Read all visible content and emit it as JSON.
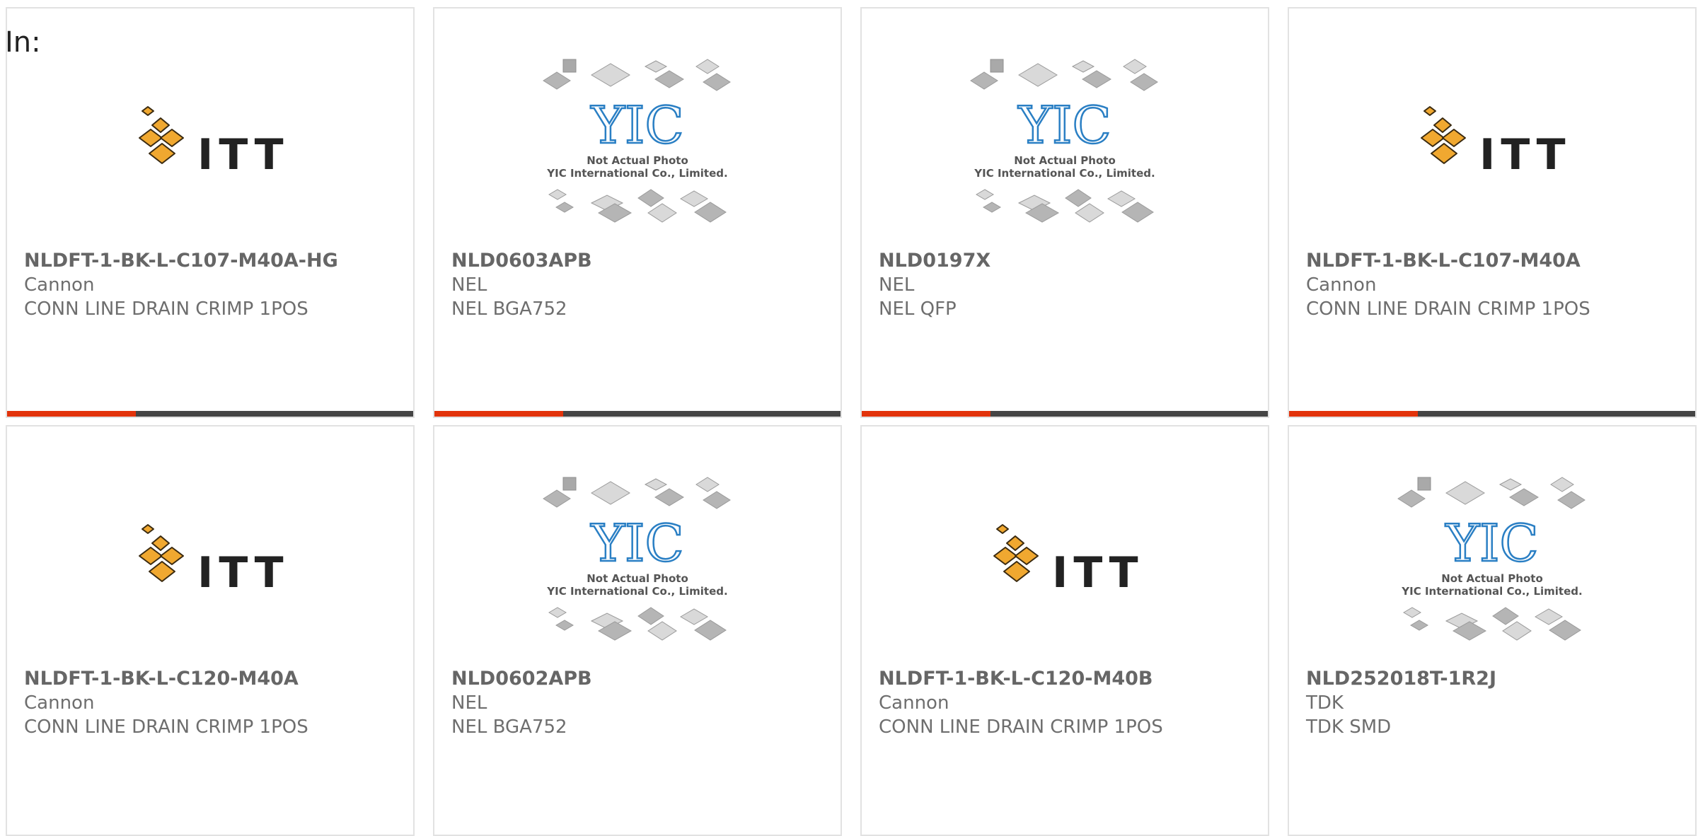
{
  "header": {
    "label": "In:"
  },
  "logos": {
    "itt": {
      "text": "ITT",
      "color": "#f0a830",
      "text_color": "#222222"
    },
    "yic": {
      "brand": "YIC",
      "line1": "Not Actual Photo",
      "line2": "YIC International Co., Limited.",
      "color": "#2a7fc4"
    }
  },
  "accent_color": "#e2330b",
  "bar_color": "#454545",
  "products": [
    {
      "part_number": "NLDFT-1-BK-L-C107-M40A-HG",
      "manufacturer": "Cannon",
      "description": "CONN LINE DRAIN CRIMP 1POS",
      "image": "itt-logo"
    },
    {
      "part_number": "NLD0603APB",
      "manufacturer": "NEL",
      "description": "NEL BGA752",
      "image": "yic-placeholder"
    },
    {
      "part_number": "NLD0197X",
      "manufacturer": "NEL",
      "description": "NEL QFP",
      "image": "yic-placeholder"
    },
    {
      "part_number": "NLDFT-1-BK-L-C107-M40A",
      "manufacturer": "Cannon",
      "description": "CONN LINE DRAIN CRIMP 1POS",
      "image": "itt-logo"
    },
    {
      "part_number": "NLDFT-1-BK-L-C120-M40A",
      "manufacturer": "Cannon",
      "description": "CONN LINE DRAIN CRIMP 1POS",
      "image": "itt-logo"
    },
    {
      "part_number": "NLD0602APB",
      "manufacturer": "NEL",
      "description": "NEL BGA752",
      "image": "yic-placeholder"
    },
    {
      "part_number": "NLDFT-1-BK-L-C120-M40B",
      "manufacturer": "Cannon",
      "description": "CONN LINE DRAIN CRIMP 1POS",
      "image": "itt-logo"
    },
    {
      "part_number": "NLD252018T-1R2J",
      "manufacturer": "TDK",
      "description": "TDK SMD",
      "image": "yic-placeholder"
    }
  ]
}
